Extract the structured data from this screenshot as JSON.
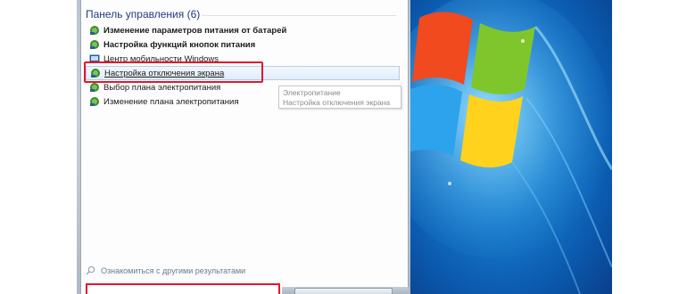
{
  "start_menu": {
    "group_header": "Панель управления (6)",
    "results": [
      {
        "label": "Изменение параметров питания от батарей",
        "icon": "power-options-icon",
        "bold": true,
        "highlighted": false
      },
      {
        "label": "Настройка функций кнопок питания",
        "icon": "power-options-icon",
        "bold": true,
        "highlighted": false
      },
      {
        "label": "Центр мобильности Windows",
        "icon": "mobility-center-icon",
        "bold": false,
        "highlighted": false
      },
      {
        "label": "Настройка отключения экрана",
        "icon": "power-options-icon",
        "bold": false,
        "highlighted": true
      },
      {
        "label": "Выбор плана электропитания",
        "icon": "power-options-icon",
        "bold": false,
        "highlighted": false
      },
      {
        "label": "Изменение плана электропитания",
        "icon": "power-options-icon",
        "bold": false,
        "highlighted": false
      }
    ],
    "tooltip": {
      "line1": "Электропитание",
      "line2": "Настройка отключения экрана"
    },
    "see_more": "Ознакомиться с другими результатами"
  },
  "colors": {
    "header_text": "#1e3b82",
    "highlight_border": "#e0182e",
    "desktop_blue": "#1a7fd0"
  }
}
